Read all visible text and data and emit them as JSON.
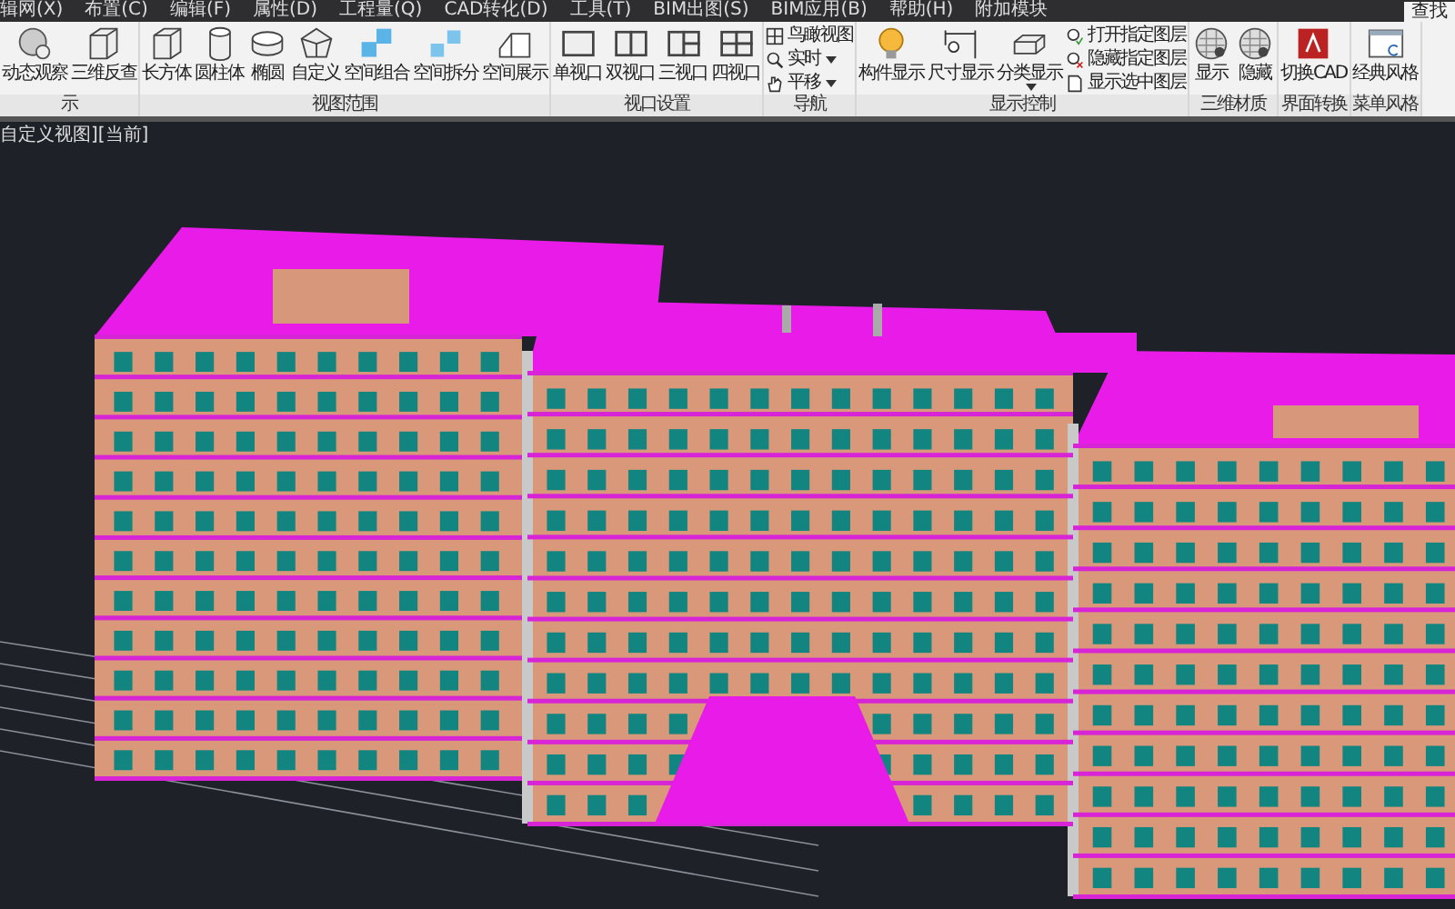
{
  "menu_bar": {
    "items": [
      "辑网(X)",
      "布置(C)",
      "编辑(F)",
      "属性(D)",
      "工程量(Q)",
      "CAD转化(D)",
      "工具(T)",
      "BIM出图(S)",
      "BIM应用(B)",
      "帮助(H)",
      "附加模块"
    ],
    "search": "查找"
  },
  "ribbon": {
    "groups": [
      {
        "label": "示",
        "buttons": [
          {
            "label": "动态观察"
          },
          {
            "label": "三维反查"
          }
        ]
      },
      {
        "label": "视图范围",
        "buttons": [
          {
            "label": "长方体"
          },
          {
            "label": "圆柱体"
          },
          {
            "label": "椭圆"
          },
          {
            "label": "自定义"
          },
          {
            "label": "空间组合"
          },
          {
            "label": "空间拆分"
          },
          {
            "label": "空间展示"
          }
        ]
      },
      {
        "label": "视口设置",
        "buttons": [
          {
            "label": "单视口"
          },
          {
            "label": "双视口"
          },
          {
            "label": "三视口"
          },
          {
            "label": "四视口"
          }
        ]
      },
      {
        "label": "导航",
        "small_items": [
          {
            "label": "鸟瞰视图",
            "dropdown": false
          },
          {
            "label": "实时",
            "dropdown": true
          },
          {
            "label": "平移",
            "dropdown": true
          }
        ]
      },
      {
        "label": "显示控制",
        "buttons": [
          {
            "label": "构件显示",
            "dropdown": false
          },
          {
            "label": "尺寸显示",
            "dropdown": false
          },
          {
            "label": "分类显示",
            "dropdown": true
          }
        ],
        "small_items": [
          {
            "label": "打开指定图层",
            "dropdown": false
          },
          {
            "label": "隐藏指定图层",
            "dropdown": false
          },
          {
            "label": "显示选中图层",
            "dropdown": false
          }
        ]
      },
      {
        "label": "三维材质",
        "buttons": [
          {
            "label": "显示"
          },
          {
            "label": "隐藏"
          }
        ]
      },
      {
        "label": "界面转换",
        "buttons": [
          {
            "label": "切换CAD"
          }
        ]
      },
      {
        "label": "菜单风格",
        "buttons": [
          {
            "label": "经典风格"
          }
        ]
      }
    ]
  },
  "viewport": {
    "label": "自定义视图][当前]"
  }
}
